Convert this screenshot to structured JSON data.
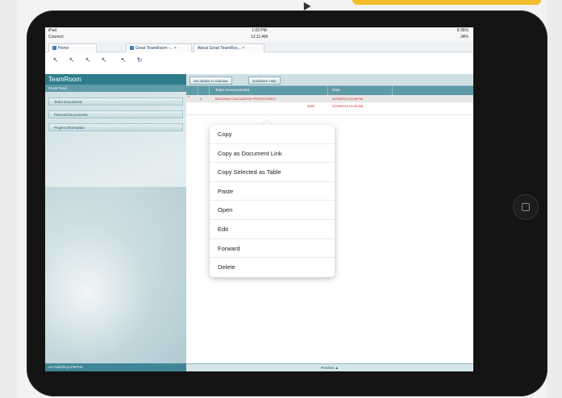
{
  "status_bar": {
    "carrier": "iPad",
    "time": "1:03 PM",
    "battery": "8 95%",
    "secondary_carrier": "Connect",
    "secondary_time": "12:11 AM",
    "secondary_battery": "34%"
  },
  "tabs": [
    {
      "label": "Home",
      "icon": "home-icon"
    },
    {
      "label": "Great TeamRoom -... ×",
      "icon": "document-icon"
    },
    {
      "label": "About Great TeamRoo... ×",
      "icon": "document-icon"
    }
  ],
  "toolbar_icons": [
    "back-icon",
    "forward-icon",
    "refresh-icon",
    "stop-icon",
    "search-icon",
    "reload-icon"
  ],
  "sidebar": {
    "title": "TeamRoom",
    "subtitle": "Great Team",
    "items": [
      "Team Documents",
      "Personal Documents",
      "Project Information"
    ],
    "footer": "on Pads/tinyAPBPHS"
  },
  "main_toolbar": {
    "buttons": [
      "Set Status to Inactive",
      "Database Help"
    ]
  },
  "view": {
    "columns": [
      "Team Announcement",
      "Date"
    ],
    "rows": [
      {
        "marker": "*",
        "expand": "4",
        "title": "BUILDING EVACUATION PROCEDURES",
        "date": "02/08/2019 03:08 PM",
        "selected": true
      },
      {
        "marker": "",
        "expand": "",
        "title": "5665",
        "date": "02/08/2019 04:45 AM",
        "selected": false
      }
    ]
  },
  "context_menu": {
    "items": [
      "Copy",
      "Copy as Document Link",
      "Copy Selected as Table",
      "Paste",
      "Open",
      "Edit",
      "Forward",
      "Delete"
    ]
  },
  "bottom_bar": {
    "label": "Preview ▲"
  },
  "colors": {
    "accent": "#2d7c8c",
    "header": "#5f9aa7",
    "unread_text": "#c8251f",
    "yellow_tab": "#f5bd2c"
  }
}
